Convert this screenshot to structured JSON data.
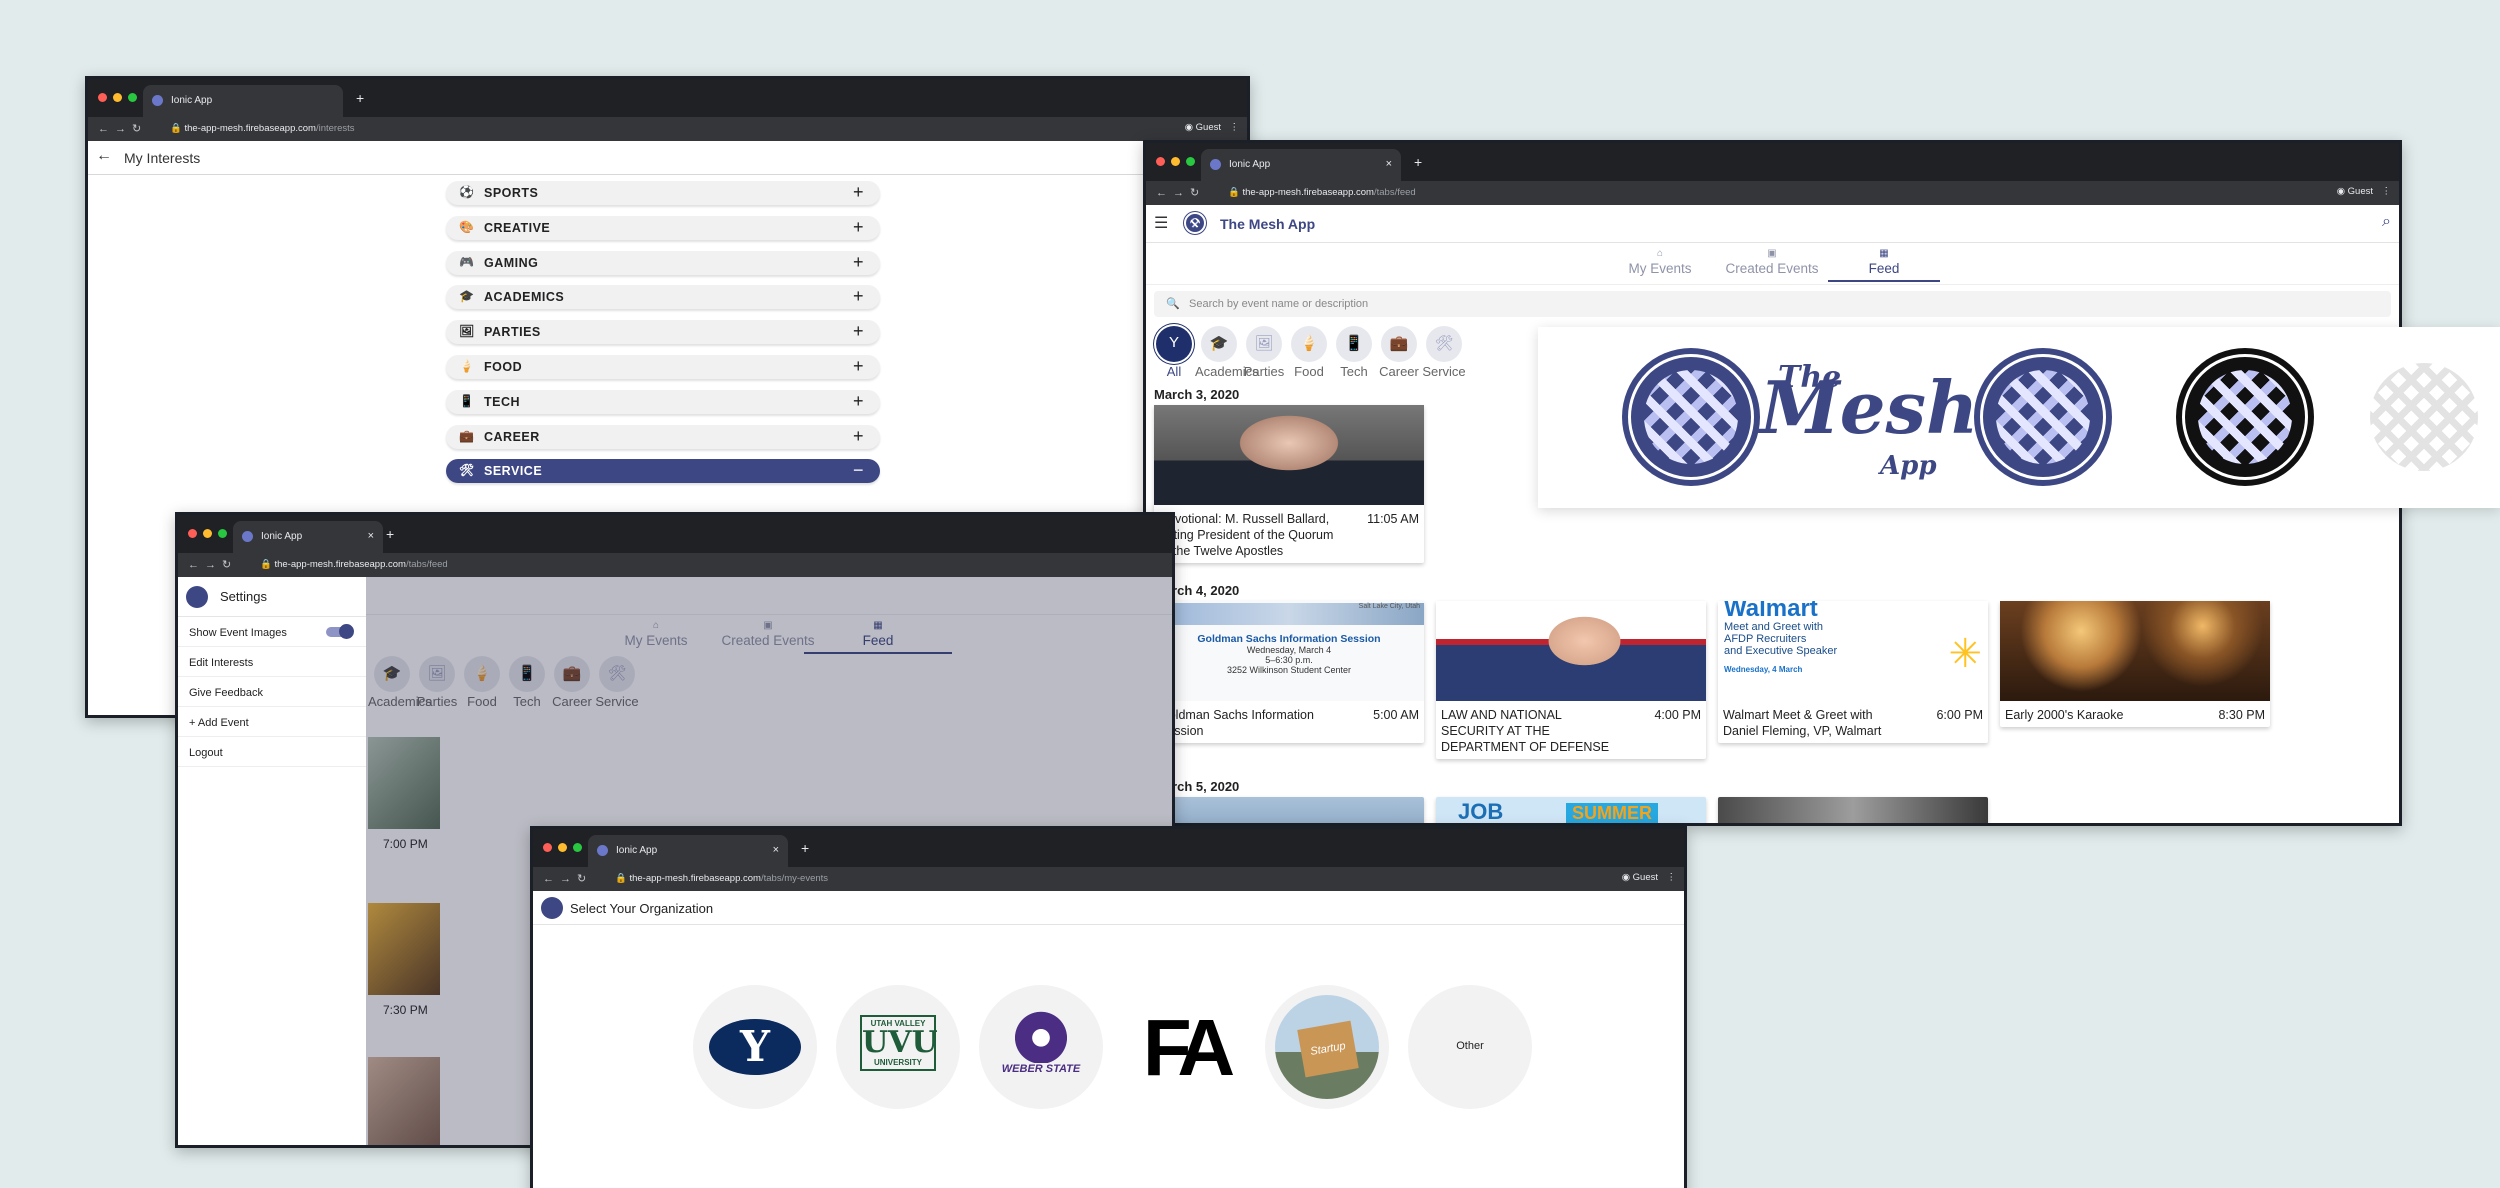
{
  "browser": {
    "tab_title": "Ionic App",
    "guest_label": "Guest",
    "host": "the-app-mesh.firebaseapp.com"
  },
  "interests_window": {
    "path": "/interests",
    "header_title": "My Interests",
    "items": [
      {
        "label": "SPORTS",
        "icon": "⚽",
        "expanded": false,
        "toggle": "+"
      },
      {
        "label": "CREATIVE",
        "icon": "🎨",
        "expanded": false,
        "toggle": "+"
      },
      {
        "label": "GAMING",
        "icon": "🎮",
        "expanded": false,
        "toggle": "+"
      },
      {
        "label": "ACADEMICS",
        "icon": "🎓",
        "expanded": false,
        "toggle": "+"
      },
      {
        "label": "PARTIES",
        "icon": "🖼",
        "expanded": false,
        "toggle": "+"
      },
      {
        "label": "FOOD",
        "icon": "🍦",
        "expanded": false,
        "toggle": "+"
      },
      {
        "label": "TECH",
        "icon": "📱",
        "expanded": false,
        "toggle": "+"
      },
      {
        "label": "CAREER",
        "icon": "💼",
        "expanded": false,
        "toggle": "+"
      },
      {
        "label": "SERVICE",
        "icon": "🛠",
        "expanded": true,
        "toggle": "−"
      }
    ]
  },
  "feed_window": {
    "path": "/tabs/feed",
    "app_title": "The Mesh App",
    "tabs": {
      "my_events": "My Events",
      "created_events": "Created Events",
      "feed": "Feed"
    },
    "search_placeholder": "Search by event name or description",
    "categories": [
      "All",
      "Academics",
      "Parties",
      "Food",
      "Tech",
      "Career",
      "Service"
    ],
    "sections": [
      {
        "date": "March 3, 2020",
        "events": [
          {
            "title": "Devotional: M. Russell Ballard, Acting President of the Quorum of the Twelve Apostles",
            "time": "11:05 AM"
          }
        ]
      },
      {
        "date": "March 4, 2020",
        "events": [
          {
            "title": "Goldman Sachs Information Session",
            "time": "5:00 AM",
            "poster": {
              "place": "Salt Lake City, Utah",
              "heading": "Goldman Sachs Information Session",
              "line1": "Wednesday, March 4",
              "line2": "5–6:30 p.m.",
              "line3": "3252 Wilkinson Student Center"
            }
          },
          {
            "title": "LAW AND NATIONAL SECURITY AT THE DEPARTMENT OF DEFENSE",
            "time": "4:00 PM"
          },
          {
            "title": "Walmart Meet & Greet with Daniel Fleming, VP, Walmart",
            "time": "6:00 PM",
            "poster": {
              "brand": "Walmart",
              "l1": "Meet and Greet with",
              "l2": "AFDP Recruiters",
              "l3": "and Executive Speaker",
              "date": "Wednesday, 4 March"
            }
          },
          {
            "title": "Early 2000's Karaoke",
            "time": "8:30 PM"
          }
        ]
      },
      {
        "date": "March 5, 2020",
        "events": [
          {
            "title": "",
            "time": "",
            "poster": {
              "t1": "JOB",
              "t2": "SUMMER"
            }
          }
        ]
      }
    ]
  },
  "banner": {
    "the": "The",
    "mesh": "Mesh",
    "app": "App",
    "colors": {
      "primary": "#3d4784",
      "black": "#111111",
      "light": "#e3e3e3"
    }
  },
  "settings_window": {
    "path": "/tabs/feed",
    "menu_title": "Settings",
    "items": [
      "Show Event Images",
      "Edit Interests",
      "Give Feedback",
      "+ Add Event",
      "Logout"
    ],
    "show_images_on": true,
    "tabs": {
      "my_events": "My Events",
      "created_events": "Created Events",
      "feed": "Feed"
    },
    "categories": [
      "Academics",
      "Parties",
      "Food",
      "Tech",
      "Career",
      "Service"
    ],
    "times": [
      "7:00 PM",
      "7:30 PM"
    ]
  },
  "org_window": {
    "path": "/tabs/my-events",
    "title": "Select Your Organization",
    "orgs": [
      {
        "name": "BYU",
        "logo_text": "Y"
      },
      {
        "name": "UVU",
        "logo_top": "UTAH VALLEY",
        "logo_mid": "UVU",
        "logo_bot": "UNIVERSITY"
      },
      {
        "name": "Weber State",
        "logo_text": "WEBER STATE"
      },
      {
        "name": "FA",
        "logo_text": "FA"
      },
      {
        "name": "Startup",
        "logo_text": "Startup"
      },
      {
        "name": "Other",
        "logo_text": "Other"
      }
    ]
  }
}
